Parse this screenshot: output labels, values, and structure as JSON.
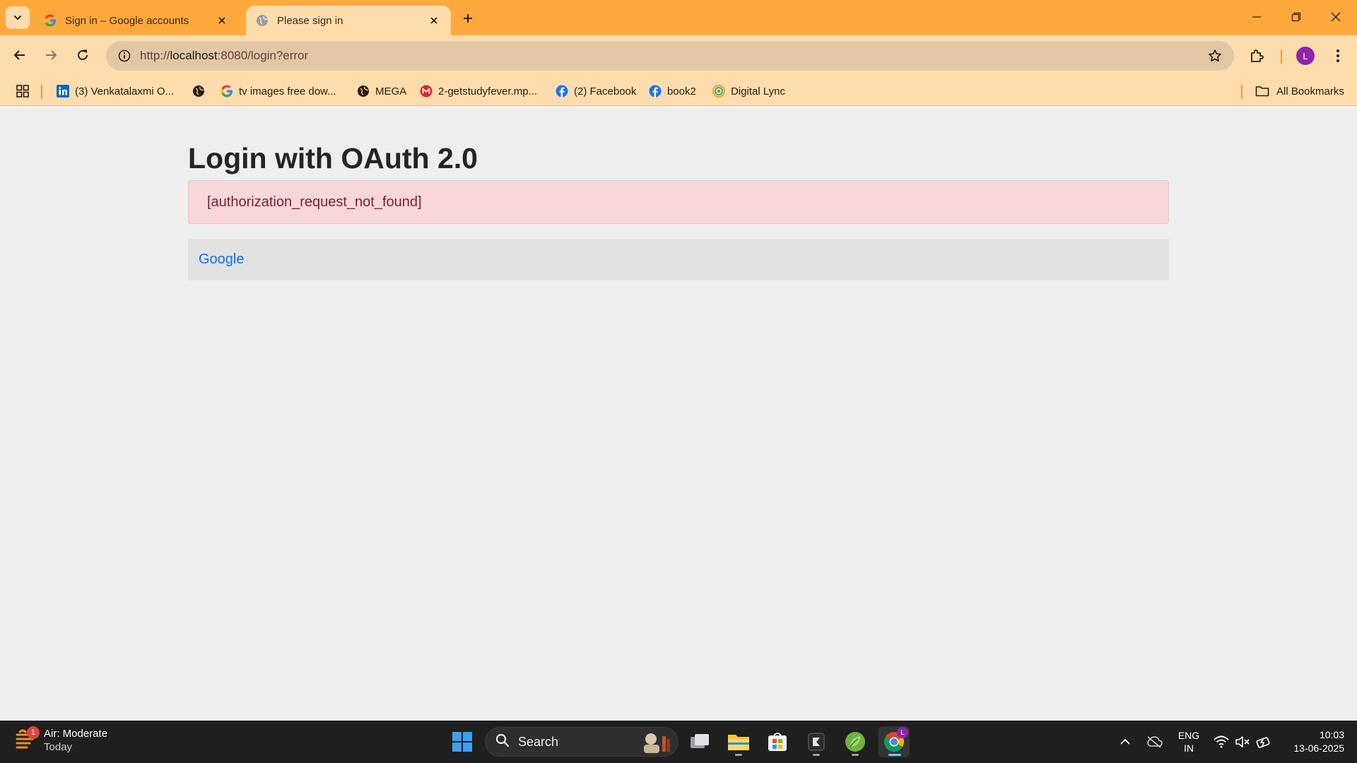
{
  "browser": {
    "tabs": [
      {
        "title": "Sign in – Google accounts",
        "favicon": "google-g-icon",
        "active": false
      },
      {
        "title": "Please sign in",
        "favicon": "globe-icon",
        "active": true
      }
    ],
    "url": {
      "scheme": "http://",
      "host": "localhost",
      "rest": ":8080/login?error"
    },
    "profile_initial": "L",
    "bookmarks": [
      {
        "label": "(3) Venkatalaxmi O...",
        "icon": "linkedin-icon"
      },
      {
        "label": "",
        "icon": "globe-icon"
      },
      {
        "label": "tv images free dow...",
        "icon": "google-g-icon"
      },
      {
        "label": "MEGA",
        "icon": "globe-icon"
      },
      {
        "label": "2-getstudyfever.mp...",
        "icon": "mega-icon"
      },
      {
        "label": "(2) Facebook",
        "icon": "facebook-icon"
      },
      {
        "label": "book2",
        "icon": "facebook-icon"
      },
      {
        "label": "Digital Lync",
        "icon": "digital-lync-icon"
      }
    ],
    "all_bookmarks_label": "All Bookmarks",
    "colors": {
      "frame": "#ffa93d",
      "toolbar": "#ffdcae",
      "omnibox": "#e2c7a4"
    }
  },
  "page": {
    "title": "Login with OAuth 2.0",
    "error_message": "[authorization_request_not_found]",
    "providers": [
      {
        "label": "Google"
      }
    ],
    "colors": {
      "alert_bg": "#f8d7da",
      "alert_text": "#842029",
      "link": "#0d6efd"
    }
  },
  "taskbar": {
    "weather": {
      "badge": "1",
      "title": "Air: Moderate",
      "subtitle": "Today"
    },
    "search_label": "Search",
    "language": {
      "line1": "ENG",
      "line2": "IN"
    },
    "time": "10:03",
    "date": "13-06-2025",
    "chrome_badge": "L"
  }
}
